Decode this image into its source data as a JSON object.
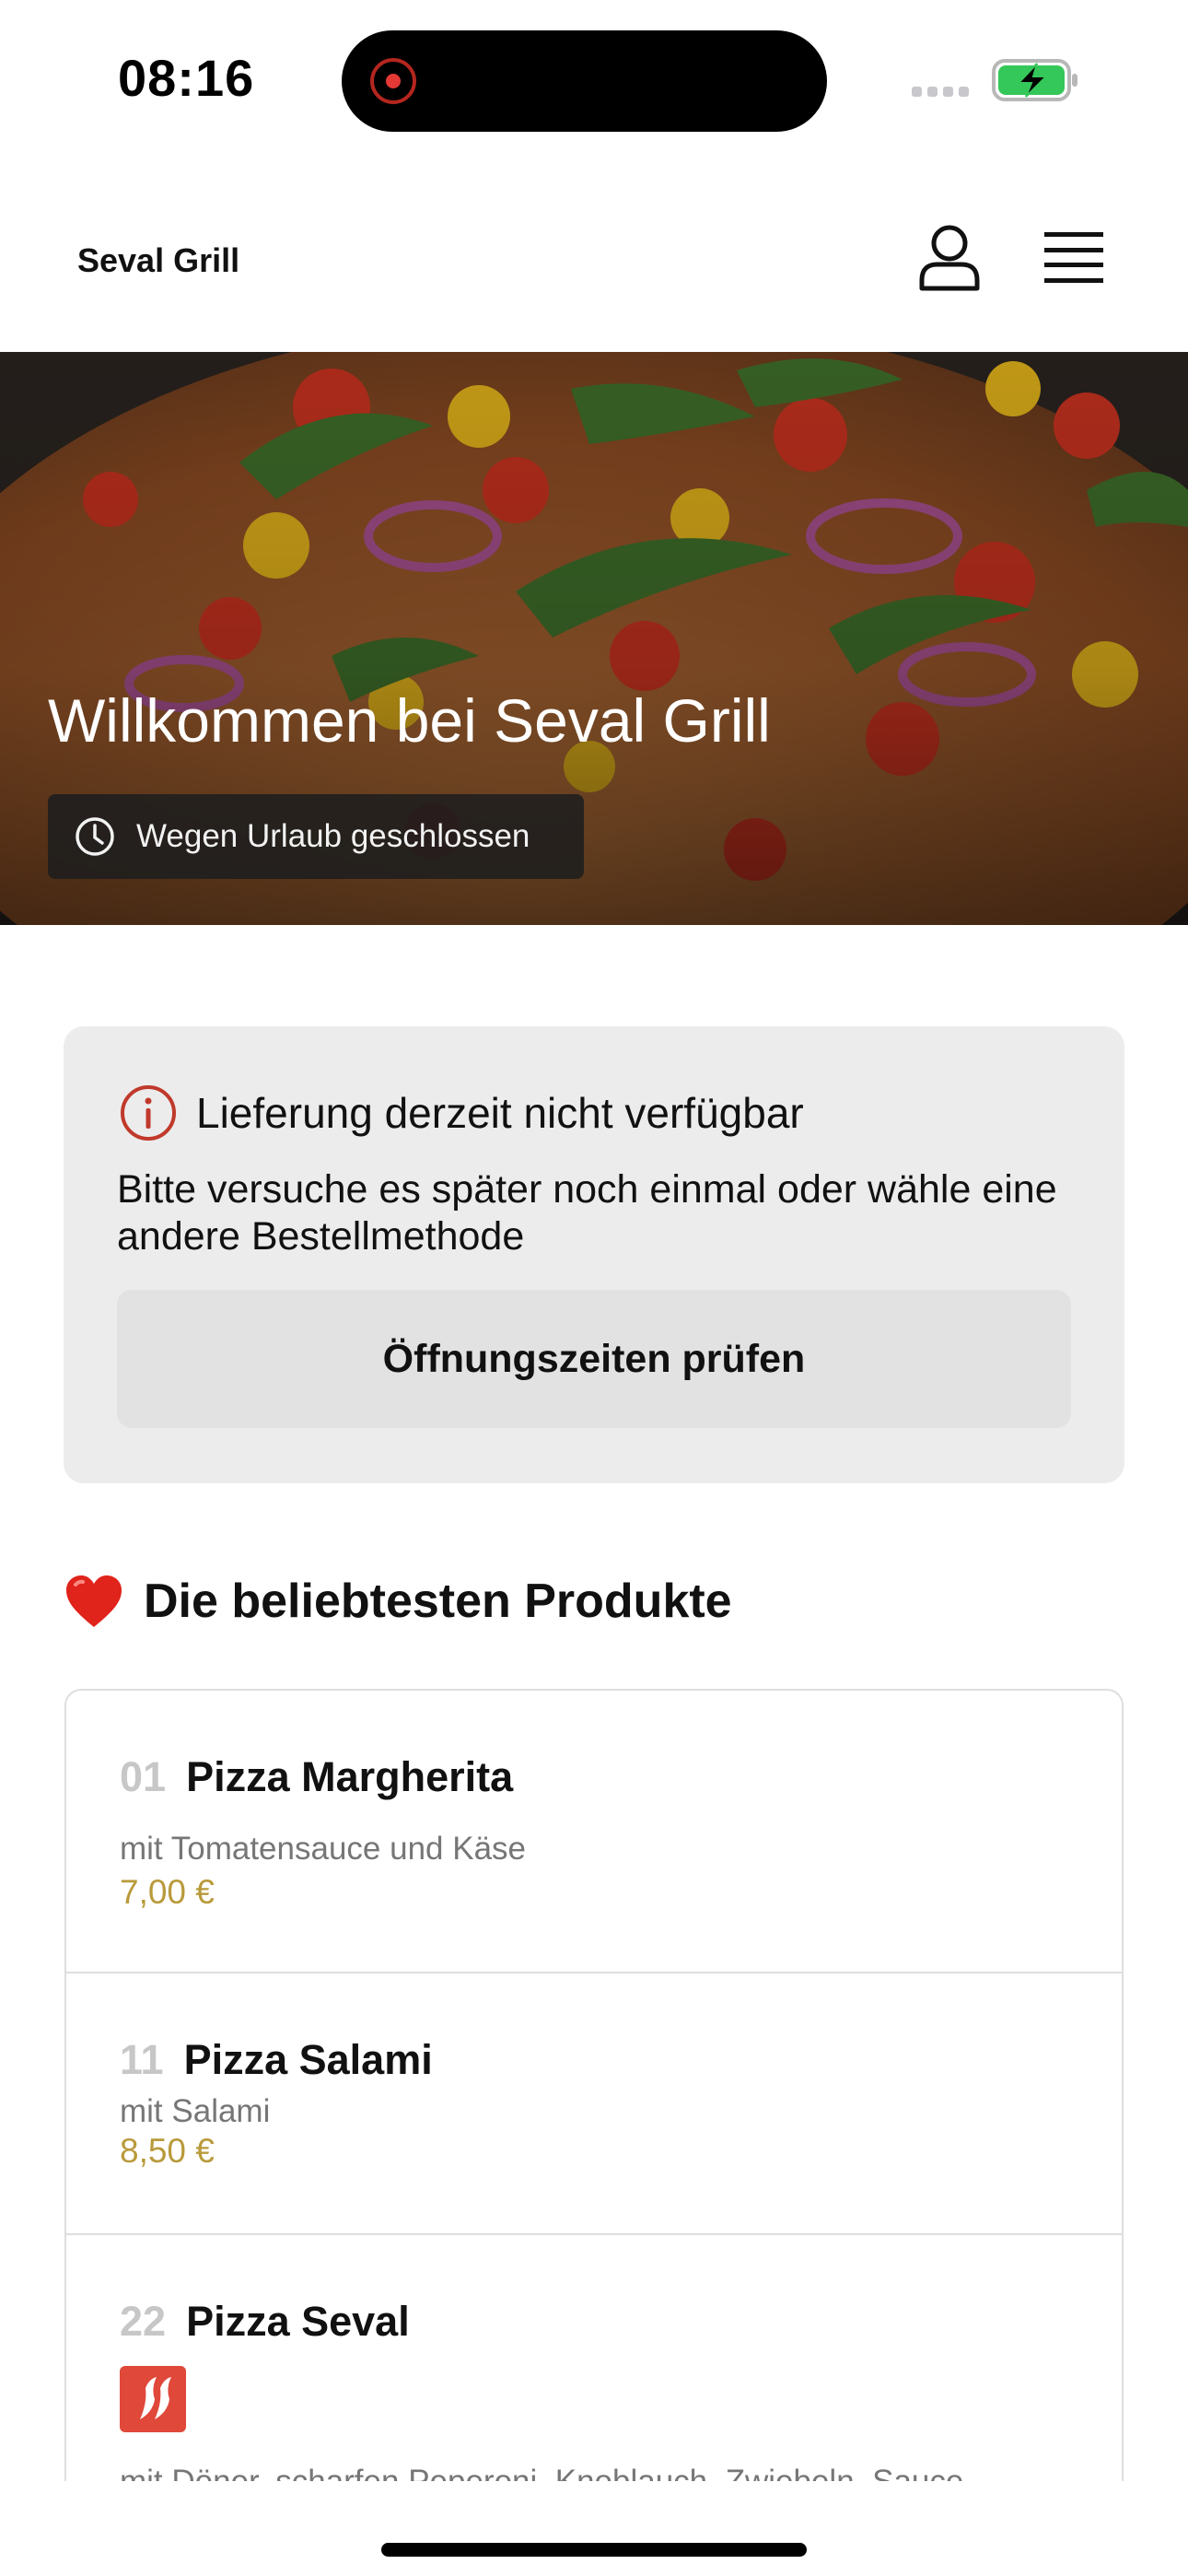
{
  "status_bar": {
    "time": "08:16",
    "recording_indicator": "screen-recording-icon",
    "battery_state": "charging",
    "battery_color": "#34c759"
  },
  "header": {
    "brand": "Seval Grill",
    "account_icon": "user-icon",
    "menu_icon": "hamburger-menu-icon"
  },
  "hero": {
    "image": "pizza-photo",
    "title": "Willkommen bei Seval Grill",
    "status_icon": "clock-icon",
    "status_text": "Wegen Urlaub geschlossen"
  },
  "notice": {
    "icon": "info-icon",
    "icon_color": "#c0392b",
    "title": "Lieferung derzeit nicht verfügbar",
    "body": "Bitte versuche es später noch einmal oder wähle eine andere Bestellmethode",
    "button_label": "Öffnungszeiten prüfen"
  },
  "popular": {
    "icon": "heart-icon",
    "title": "Die beliebtesten Produkte",
    "products": [
      {
        "number": "01",
        "name": "Pizza Margherita",
        "description": "mit Tomatensauce und Käse",
        "price": "7,00 €"
      },
      {
        "number": "11",
        "name": "Pizza Salami",
        "description": "mit Salami",
        "price": "8,50 €"
      },
      {
        "number": "22",
        "name": "Pizza Seval",
        "badge": "spicy-chili-icon",
        "description": "mit Döner, scharfen Peperoni, Knoblauch, Zwiebeln, Sauce"
      }
    ]
  },
  "colors": {
    "price": "#b99a3b",
    "spicy_badge": "#e0483a",
    "notice_background": "#ececec"
  }
}
